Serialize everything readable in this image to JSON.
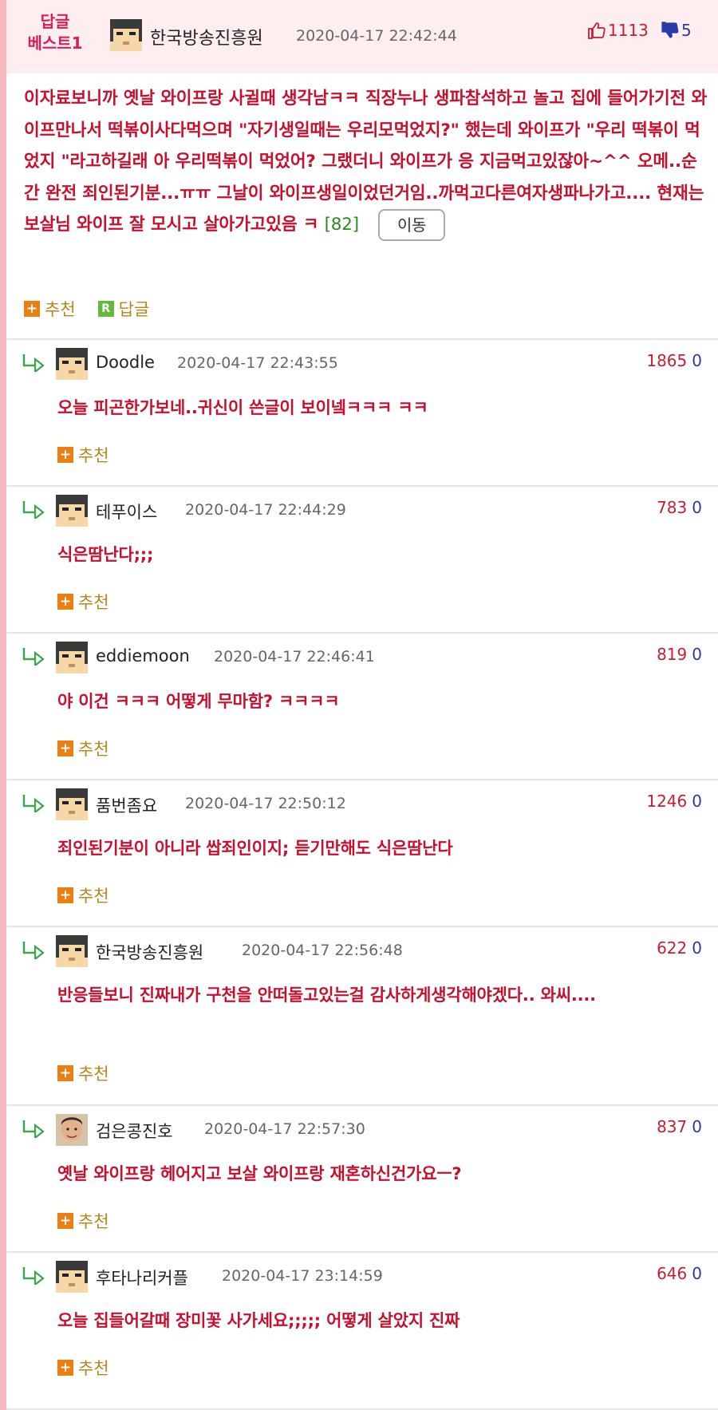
{
  "best": {
    "badge_line1": "답글",
    "badge_line2": "베스트1",
    "author": "한국방송진흥원",
    "date": "2020-04-17 22:42:44",
    "upvotes": "1113",
    "downvotes": "5",
    "body": "이자료보니까 옛날 와이프랑 사귈때 생각남ㅋㅋ 직장누나 생파참석하고 놀고 집에 들어가기전 와이프만나서 떡볶이사다먹으며 \"자기생일때는 우리모먹었지?\" 했는데 와이프가 \"우리 떡볶이 먹었지 \"라고하길래 아 우리떡볶이 먹었어? 그랬더니 와이프가 응 지금먹고있잖아~^^ 오메..순간 완전 죄인된기분...ㅠㅠ 그날이 와이프생일이었던거임..까먹고다른여자생파나가고.... 현재는 보살님 와이프 잘 모시고 살아가고있음 ㅋ",
    "ref_count": "[82]",
    "move_label": "이동",
    "recommend_label": "추천",
    "reply_label": "답글",
    "colors": {
      "header_bg": "#ffeef0",
      "badge": "#d61e5c",
      "body_text": "#c8102e"
    }
  },
  "icons": {
    "thumbs_up": "thumbs-up-icon",
    "thumbs_down": "thumbs-down-icon",
    "reply_arrow": "reply-arrow-icon",
    "plus": "plus-icon",
    "r_badge": "reply-r-icon"
  },
  "replies": [
    {
      "author": "Doodle",
      "date": "2020-04-17 22:43:55",
      "up": "1865",
      "down": "0",
      "body": "오늘 피곤한가보네..귀신이 쓴글이 보이넼ㅋㅋㅋ ㅋㅋ",
      "recommend": "추천",
      "avatar": "pixel"
    },
    {
      "author": "테푸이스",
      "date": "2020-04-17 22:44:29",
      "up": "783",
      "down": "0",
      "body": "식은땀난다;;;",
      "recommend": "추천",
      "avatar": "pixel"
    },
    {
      "author": "eddiemoon",
      "date": "2020-04-17 22:46:41",
      "up": "819",
      "down": "0",
      "body": "야 이건 ㅋㅋㅋ 어떻게 무마함? ㅋㅋㅋㅋ",
      "recommend": "추천",
      "avatar": "pixel"
    },
    {
      "author": "품번좀요",
      "date": "2020-04-17 22:50:12",
      "up": "1246",
      "down": "0",
      "body": "죄인된기분이 아니라 쌉죄인이지; 듣기만해도 식은땀난다",
      "recommend": "추천",
      "avatar": "pixel"
    },
    {
      "author": "한국방송진흥원",
      "date": "2020-04-17 22:56:48",
      "up": "622",
      "down": "0",
      "body": "반응들보니 진짜내가 구천을 안떠돌고있는걸 감사하게생각해야겠다.. 와씨....",
      "recommend": "추천",
      "avatar": "pixel"
    },
    {
      "author": "검은콩진호",
      "date": "2020-04-17 22:57:30",
      "up": "837",
      "down": "0",
      "body": "옛날 와이프랑 헤어지고 보살 와이프랑 재혼하신건가요ㅡ?",
      "recommend": "추천",
      "avatar": "photo"
    },
    {
      "author": "후타나리커플",
      "date": "2020-04-17 23:14:59",
      "up": "646",
      "down": "0",
      "body": "오늘 집들어갈때 장미꽃 사가세요;;;;; 어떻게 살았지 진짜",
      "recommend": "추천",
      "avatar": "pixel"
    }
  ]
}
